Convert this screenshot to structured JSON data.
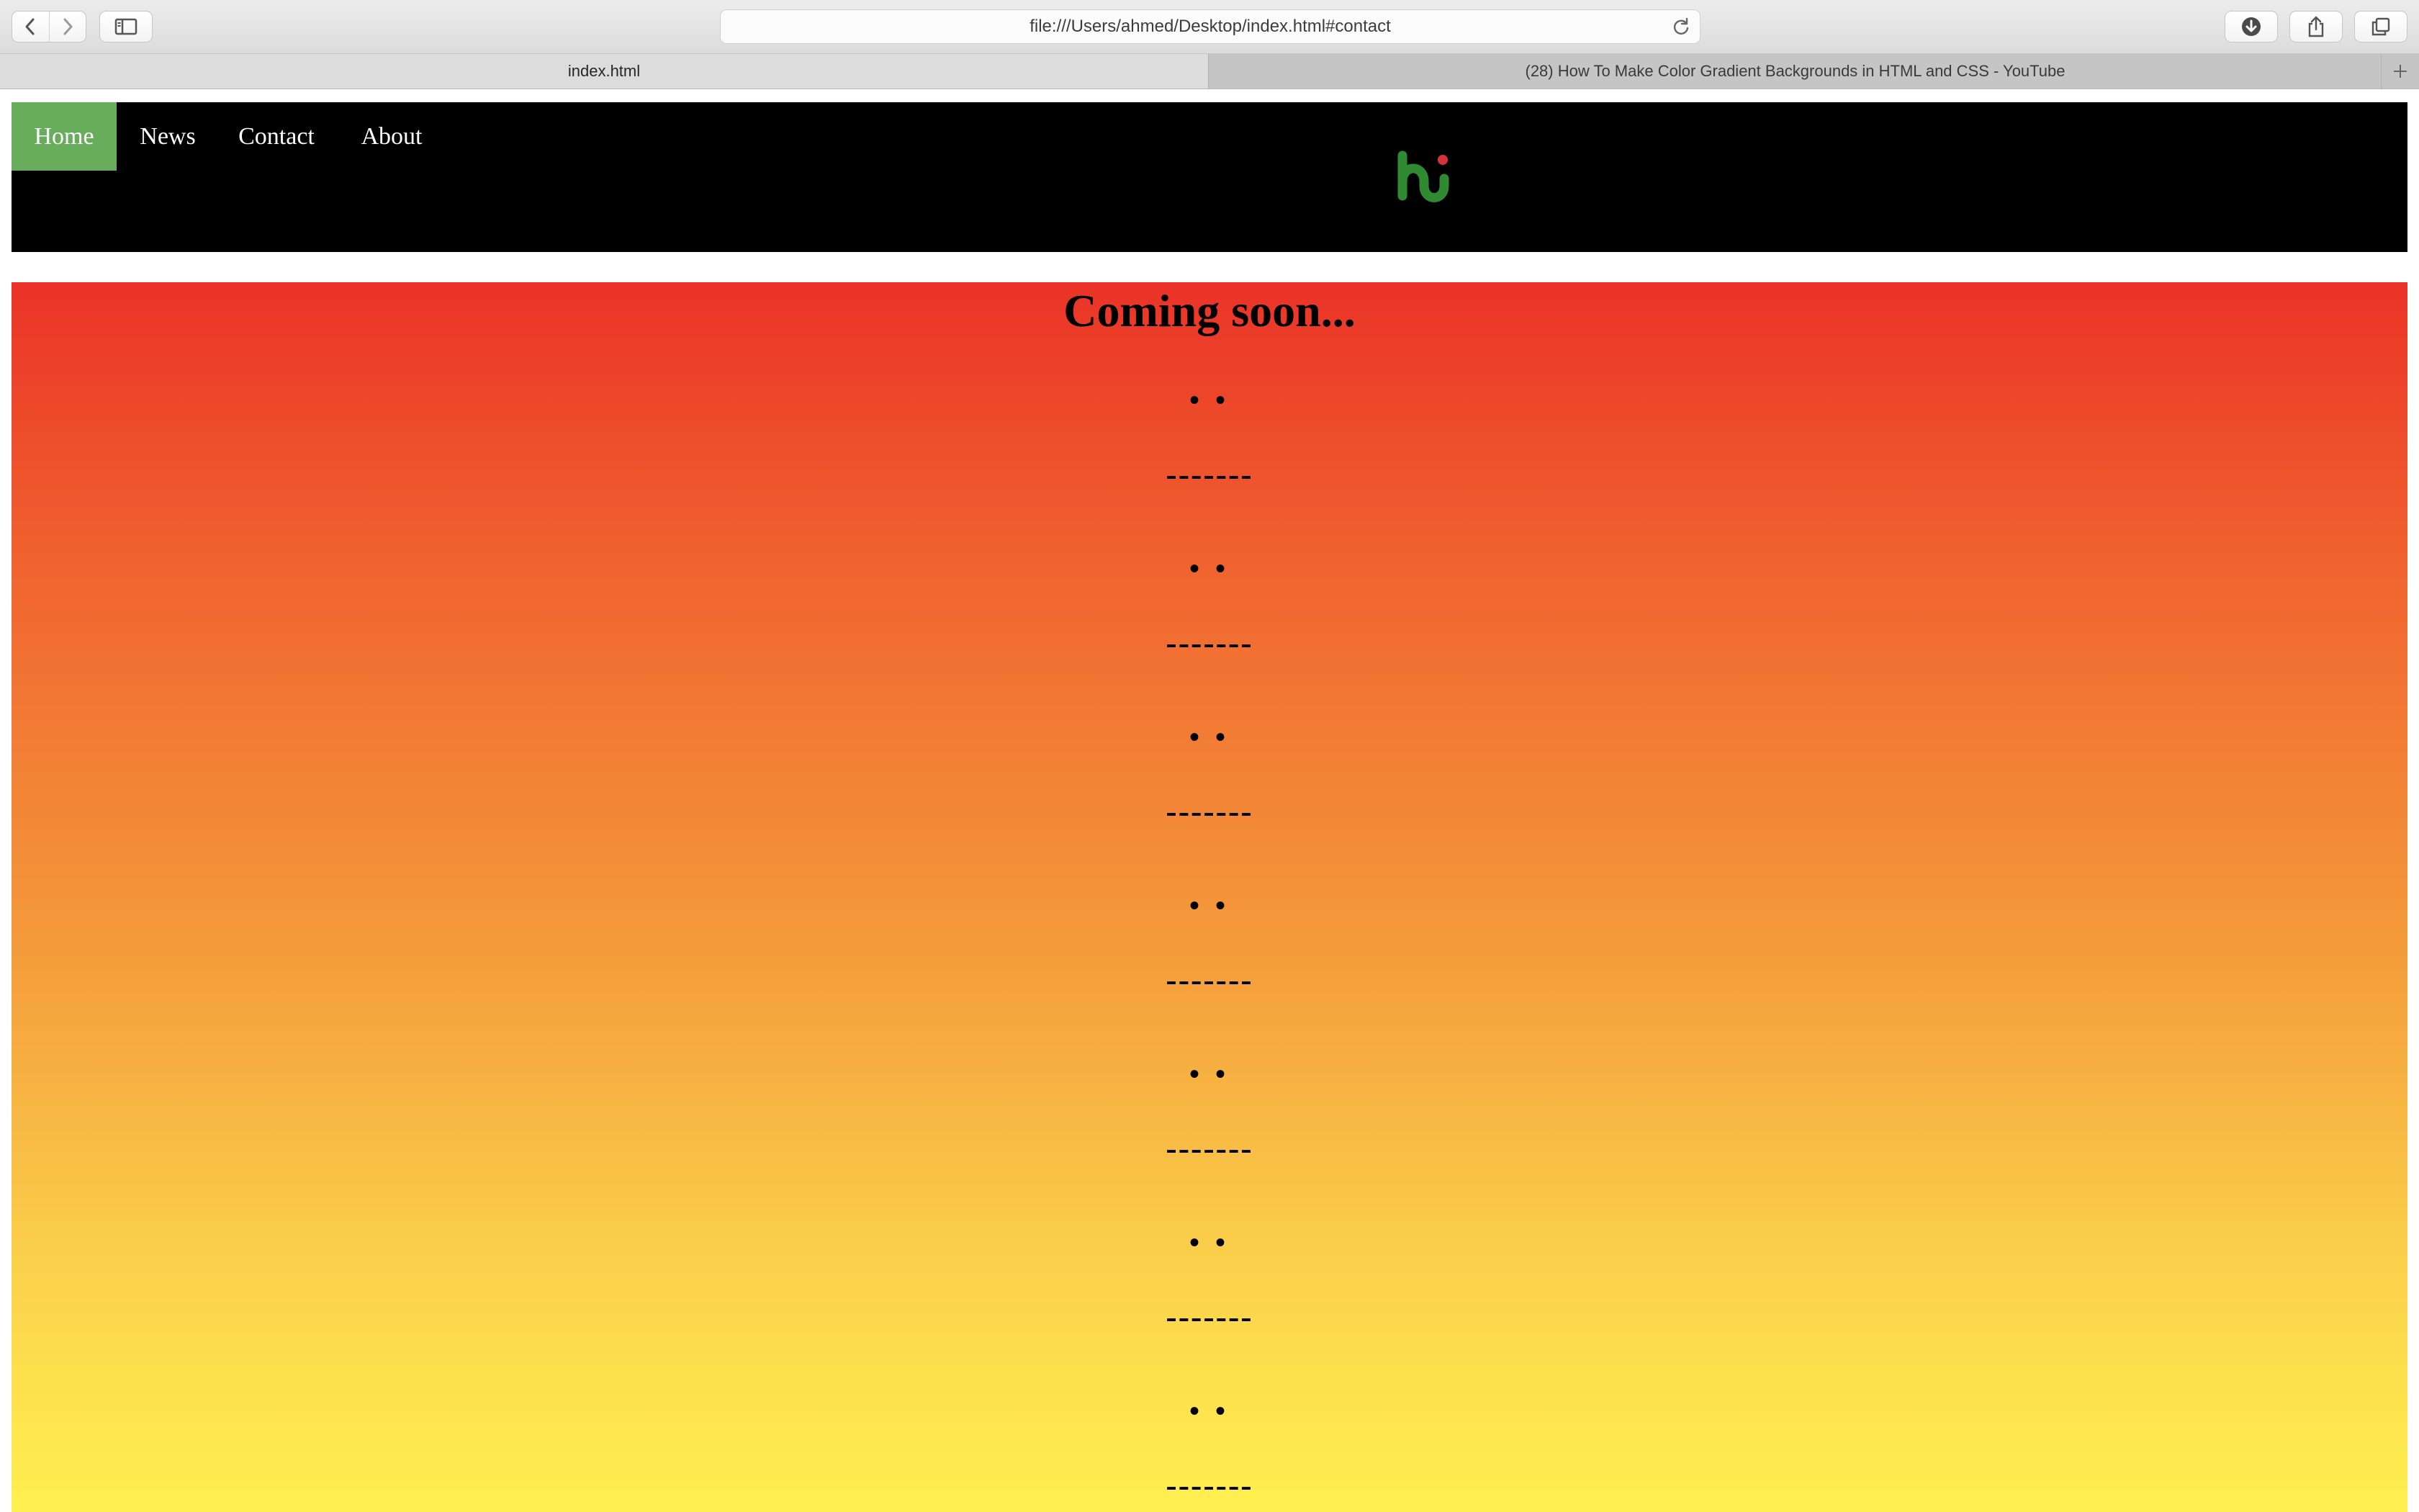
{
  "browser": {
    "url": "file:///Users/ahmed/Desktop/index.html#contact",
    "icons": [
      "back-icon",
      "forward-icon",
      "sidebar-icon",
      "reload-icon",
      "download-icon",
      "share-icon",
      "tabs-overview-icon",
      "new-tab-icon"
    ],
    "tabs": [
      {
        "label": "index.html",
        "active": true
      },
      {
        "label": "(28) How To Make Color Gradient Backgrounds in HTML and CSS - YouTube",
        "active": false
      }
    ]
  },
  "page": {
    "nav": [
      "Home",
      "News",
      "Contact",
      "About"
    ],
    "active_nav": "Home",
    "colors": {
      "nav_active": "#67ad5b",
      "header": "#000000",
      "gradient_top": "#ea3327",
      "gradient_bottom": "#fff050",
      "logo_green": "#2f8a32",
      "logo_dot": "#d8323c"
    },
    "hero": {
      "title": "Coming soon...",
      "lines": [
        "• •",
        "-------",
        "• •",
        "-------",
        "• •",
        "-------",
        "• •",
        "-------",
        "• •",
        "-------",
        "• •",
        "-------",
        "• •",
        "-------"
      ]
    }
  }
}
